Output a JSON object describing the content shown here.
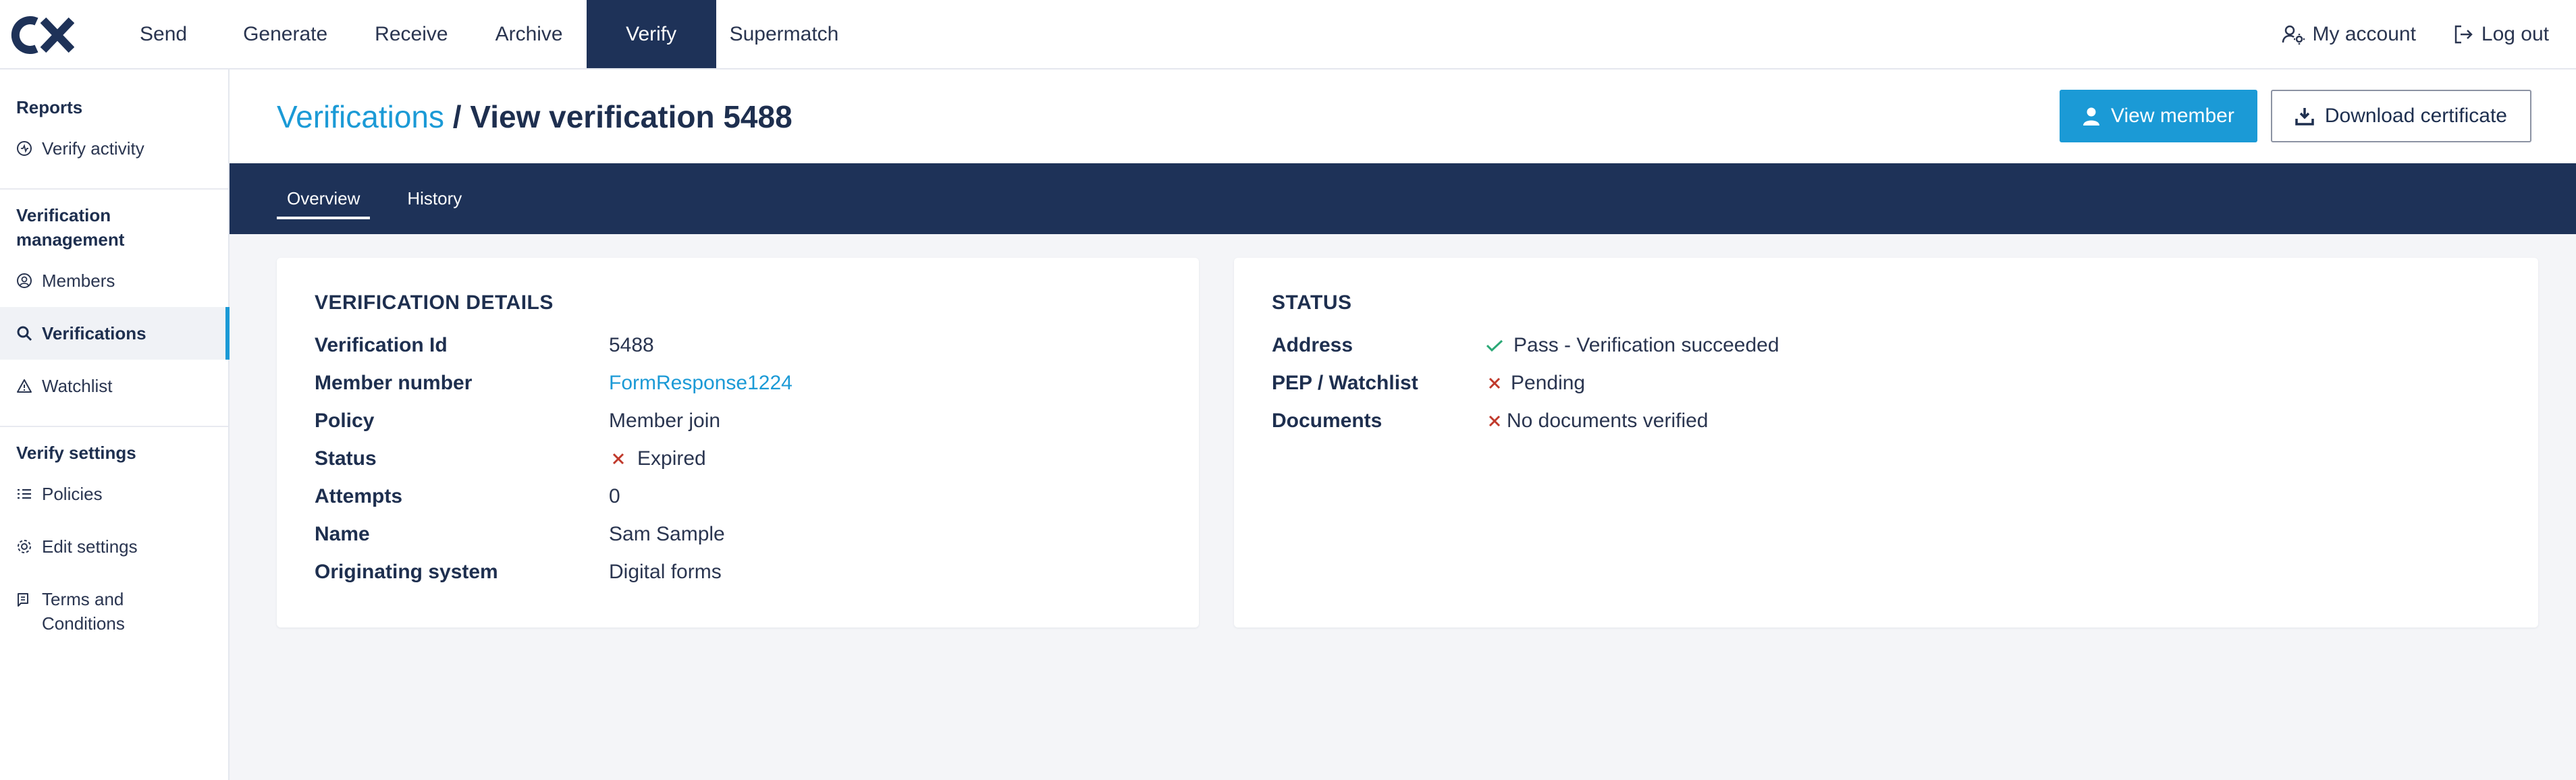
{
  "app": {
    "logo_text": "CX"
  },
  "topnav": {
    "items": [
      "Send",
      "Generate",
      "Receive",
      "Archive",
      "Verify",
      "Supermatch"
    ],
    "active_index": 4,
    "my_account": "My account",
    "log_out": "Log out"
  },
  "sidebar": {
    "sections": [
      {
        "heading": "Reports",
        "items": [
          {
            "label": "Verify activity",
            "icon": "activity-icon"
          }
        ]
      },
      {
        "heading": "Verification management",
        "items": [
          {
            "label": "Members",
            "icon": "user-circle-icon"
          },
          {
            "label": "Verifications",
            "icon": "search-icon",
            "active": true
          },
          {
            "label": "Watchlist",
            "icon": "warning-icon"
          }
        ]
      },
      {
        "heading": "Verify settings",
        "items": [
          {
            "label": "Policies",
            "icon": "list-icon"
          },
          {
            "label": "Edit settings",
            "icon": "gear-icon"
          },
          {
            "label": "Terms and Conditions",
            "icon": "document-icon"
          }
        ]
      }
    ]
  },
  "header": {
    "breadcrumb_link": "Verifications",
    "separator": "/",
    "title": "View verification 5488",
    "view_member": "View member",
    "download_certificate": "Download certificate"
  },
  "tabs": {
    "overview": "Overview",
    "history": "History"
  },
  "details": {
    "title": "VERIFICATION DETAILS",
    "rows": [
      {
        "label": "Verification Id",
        "value": "5488"
      },
      {
        "label": "Member number",
        "value": "FormResponse1224"
      },
      {
        "label": "Policy",
        "value": "Member join"
      },
      {
        "label": "Status",
        "value": "Expired"
      },
      {
        "label": "Attempts",
        "value": "0"
      },
      {
        "label": "Name",
        "value": "Sam Sample"
      },
      {
        "label": "Originating system",
        "value": "Digital forms"
      }
    ]
  },
  "status": {
    "title": "STATUS",
    "rows": [
      {
        "label": "Address",
        "value": "Pass - Verification succeeded"
      },
      {
        "label": "PEP / Watchlist",
        "value": "Pending"
      },
      {
        "label": "Documents",
        "value": "No documents verified"
      }
    ]
  },
  "colors": {
    "navy": "#1e3258",
    "accent": "#1b9ad6",
    "success": "#2aa876",
    "error": "#c0392b"
  }
}
